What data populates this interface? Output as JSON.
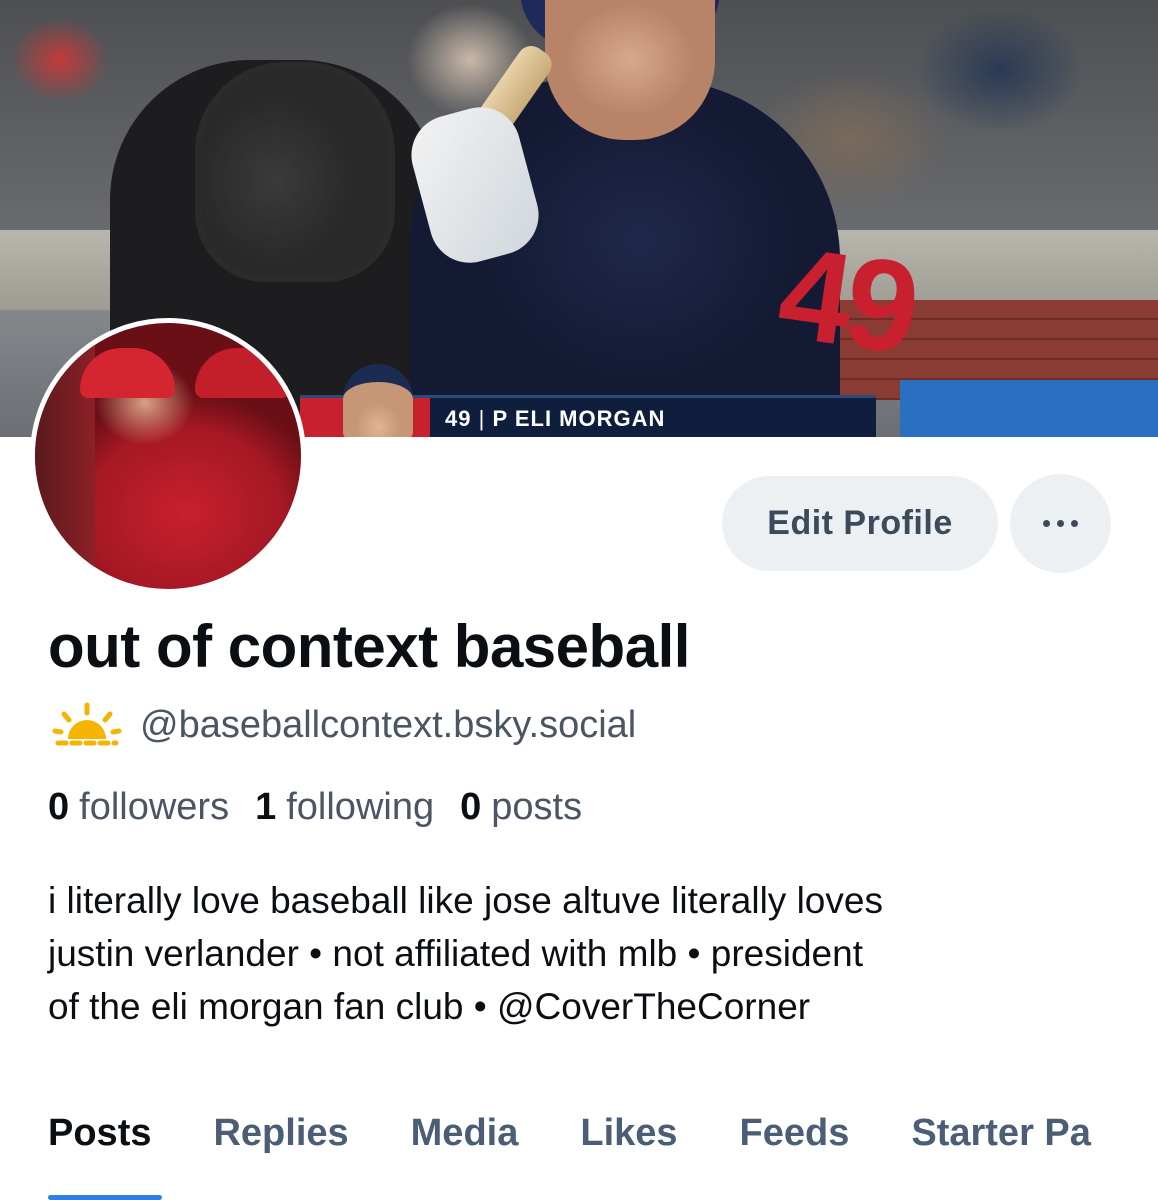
{
  "banner": {
    "caption_number": "49",
    "caption_position": "P",
    "caption_name": "ELI MORGAN"
  },
  "profile": {
    "display_name": "out of context baseball",
    "handle": "@baseballcontext.bsky.social",
    "handle_icon": "sun-icon",
    "edit_button_label": "Edit Profile",
    "more_button_icon": "ellipsis-icon"
  },
  "stats": {
    "followers_count": "0",
    "followers_label": "followers",
    "following_count": "1",
    "following_label": "following",
    "posts_count": "0",
    "posts_label": "posts"
  },
  "bio": {
    "line1": "i literally love baseball like jose altuve literally loves",
    "line2": "justin verlander • not affiliated with mlb • president",
    "line3": "of the eli morgan fan club • @CoverTheCorner"
  },
  "tabs": [
    {
      "label": "Posts",
      "active": true
    },
    {
      "label": "Replies",
      "active": false
    },
    {
      "label": "Media",
      "active": false
    },
    {
      "label": "Likes",
      "active": false
    },
    {
      "label": "Feeds",
      "active": false
    },
    {
      "label": "Starter Pa",
      "active": false
    }
  ],
  "colors": {
    "accent": "#2f7ee8",
    "button_bg": "#edf0f3",
    "muted_text": "#4b5563",
    "sun_icon": "#f5b400"
  }
}
